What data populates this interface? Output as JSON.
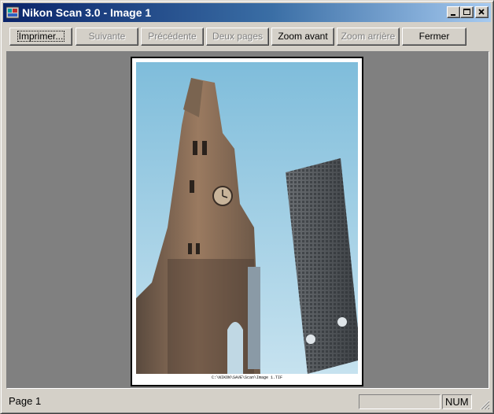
{
  "window": {
    "title": "Nikon Scan 3.0 - Image 1",
    "icon": "nikon-scan-app-icon",
    "controls": [
      "minimize-icon",
      "maximize-icon",
      "close-icon"
    ]
  },
  "toolbar": {
    "print_label": "Imprimer...",
    "next_label": "Suivante",
    "previous_label": "Précédente",
    "two_pages_label": "Deux pages",
    "zoom_in_label": "Zoom avant",
    "zoom_out_label": "Zoom arrière",
    "close_label": "Fermer"
  },
  "preview": {
    "image": "church-tower-photo",
    "caption": "C:\\NIKON\\SAVE\\Scan\\Image 1.TIF"
  },
  "status": {
    "text": "Page 1",
    "num_indicator": "NUM"
  },
  "colors": {
    "title_gradient_start": "#0a246a",
    "title_gradient_end": "#a6caf0",
    "workspace": "#808080",
    "chrome": "#d4d0c8"
  }
}
